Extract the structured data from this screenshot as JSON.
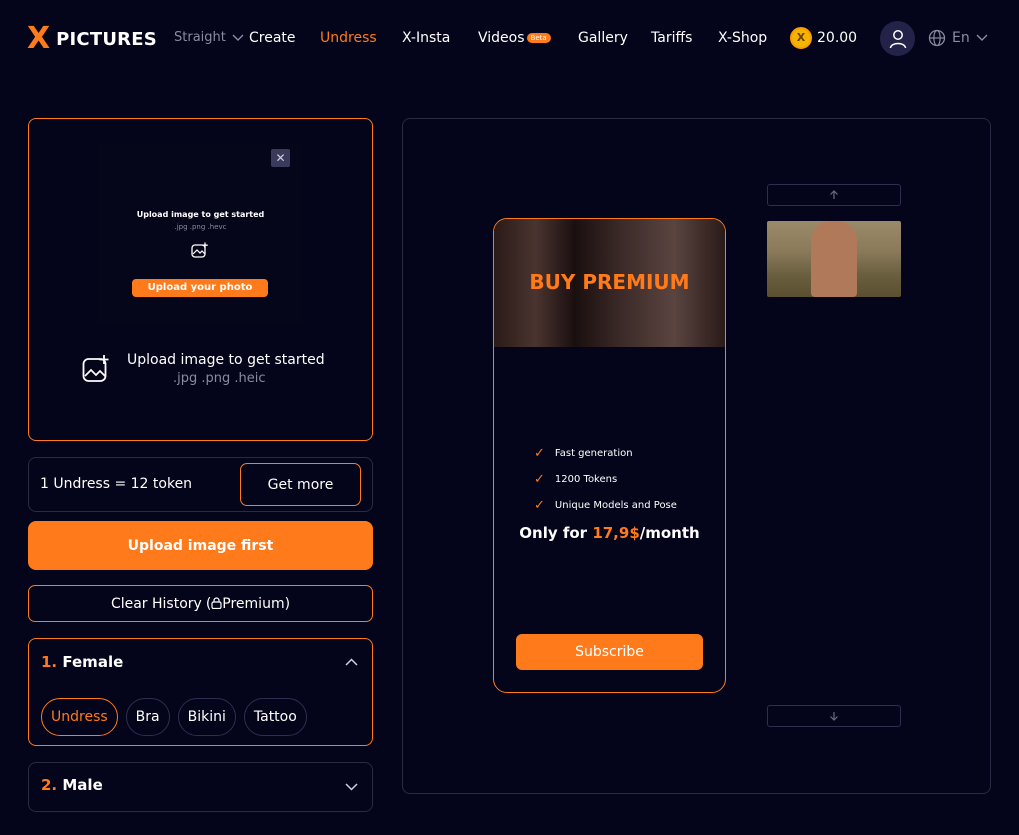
{
  "header": {
    "logo_mark": "X",
    "logo_text": "PICTURES",
    "mode_dropdown": "Straight",
    "nav": [
      {
        "label": "Create",
        "active": false
      },
      {
        "label": "Undress",
        "active": true
      },
      {
        "label": "X-Insta",
        "active": false
      },
      {
        "label": "Videos",
        "active": false,
        "badge": "Beta"
      },
      {
        "label": "Gallery",
        "active": false
      },
      {
        "label": "Tariffs",
        "active": false
      },
      {
        "label": "X-Shop",
        "active": false
      }
    ],
    "coin_glyph": "X",
    "balance": "20.00",
    "language": "En"
  },
  "upload": {
    "thumb_title": "Upload image to get started",
    "thumb_exts": ".jpg .png .hevc",
    "thumb_button": "Upload your photo",
    "title": "Upload image to get started",
    "exts": ".jpg .png .heic"
  },
  "tokens": {
    "cost_text": "1 Undress = 12 token",
    "get_more": "Get more"
  },
  "actions": {
    "upload_first": "Upload image first",
    "clear_history": "Clear History",
    "clear_history_lock": "Premium"
  },
  "sections": {
    "female": {
      "number": "1.",
      "label": "Female",
      "chips": [
        {
          "label": "Undress",
          "active": true
        },
        {
          "label": "Bra",
          "active": false
        },
        {
          "label": "Bikini",
          "active": false
        },
        {
          "label": "Tattoo",
          "active": false
        }
      ]
    },
    "male": {
      "number": "2.",
      "label": "Male"
    }
  },
  "promo": {
    "title": "BUY PREMIUM",
    "features": [
      "Fast generation",
      "1200 Tokens",
      "Unique Models and Pose"
    ],
    "price_prefix": "Only for ",
    "price_value": "17,9$",
    "price_suffix": "/month",
    "subscribe": "Subscribe"
  },
  "colors": {
    "accent": "#ff7a1a",
    "background": "#04041a",
    "border": "#2a2a44"
  },
  "icons": {
    "close": "close-icon",
    "add_image": "add-image-icon",
    "lock": "lock-icon",
    "globe": "globe-icon",
    "user": "user-icon"
  }
}
